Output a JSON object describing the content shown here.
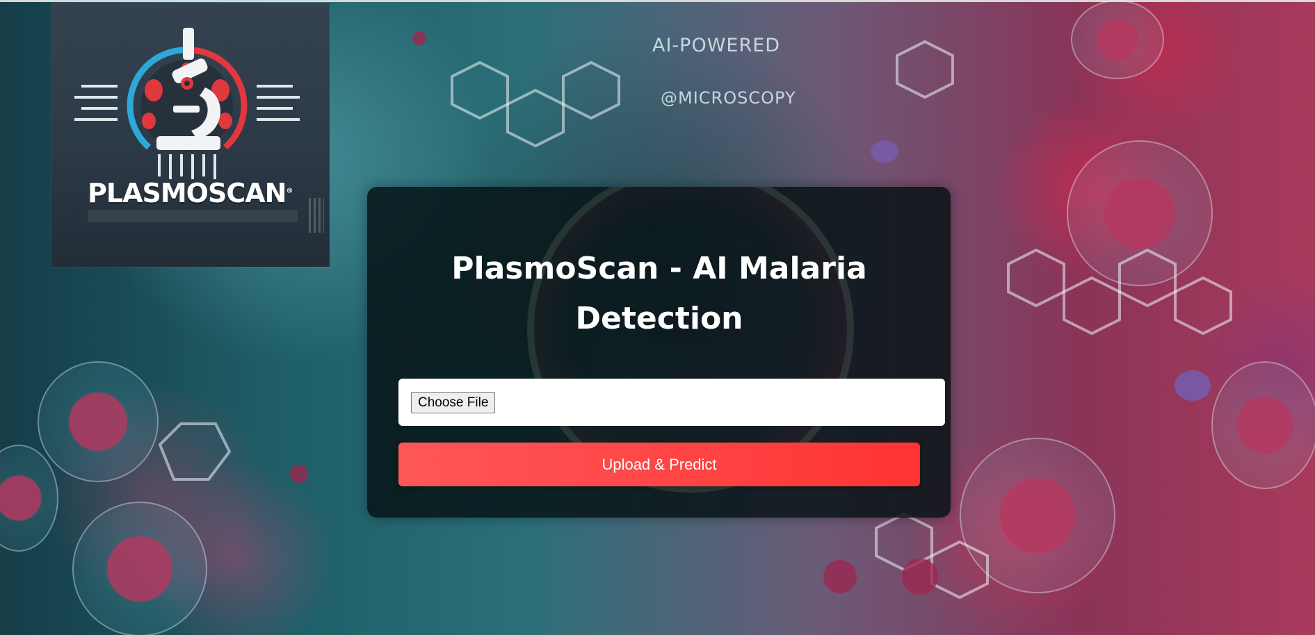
{
  "background": {
    "text_top": "AI-POWERED",
    "text_bottom": "@MICROSCOPY"
  },
  "logo": {
    "wordmark": "PLASMOSCAN",
    "mark": "®"
  },
  "main": {
    "title": "PlasmoScan - AI Malaria Detection",
    "file_input": {
      "button_label": "Choose File"
    },
    "submit_label": "Upload & Predict"
  },
  "colors": {
    "accent": "#ff4a4a",
    "panel": "#061214",
    "brand_red": "#e0383e",
    "brand_blue": "#2ea8d8"
  }
}
